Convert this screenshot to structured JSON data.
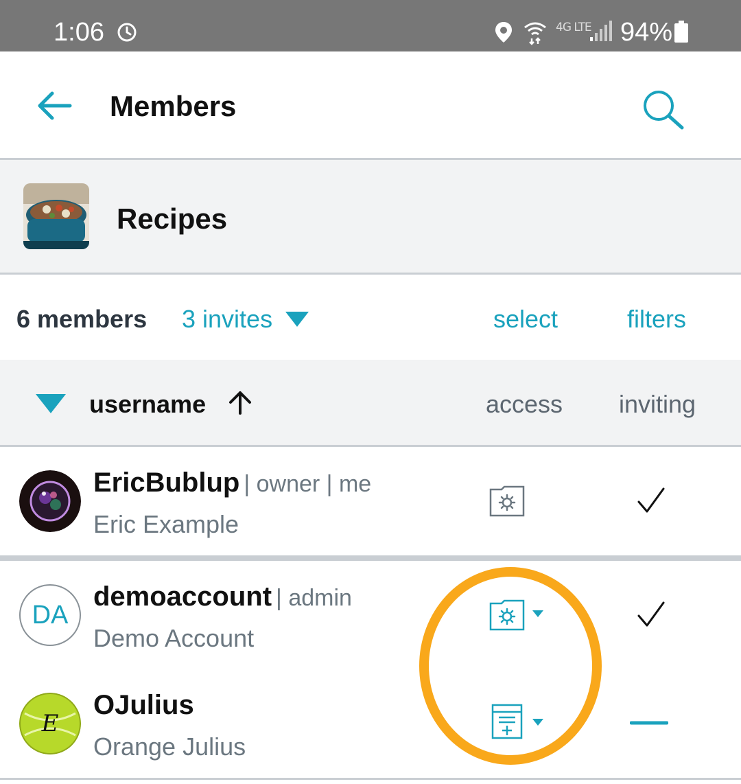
{
  "status_bar": {
    "time": "1:06",
    "network": "4G LTE",
    "battery": "94%",
    "icons": [
      "alarm-clock-icon",
      "location-icon",
      "wifi-icon",
      "signal-icon",
      "battery-icon"
    ]
  },
  "app_bar": {
    "title": "Members",
    "back_icon": "back-arrow-icon",
    "search_icon": "search-icon"
  },
  "group": {
    "name": "Recipes",
    "thumbnail": "recipe-photo"
  },
  "summary": {
    "members": "6 members",
    "invites": "3 invites",
    "select": "select",
    "filters": "filters"
  },
  "columns": {
    "username": "username",
    "access": "access",
    "inviting": "inviting",
    "sort": "ascending"
  },
  "members": [
    {
      "username": "EricBublup",
      "role": "| owner | me",
      "full_name": "Eric Example",
      "avatar": "bubble-photo",
      "access_icon": "folder-settings-icon",
      "access_editable": false,
      "inviting": "check"
    },
    {
      "username": "demoaccount",
      "role": "| admin",
      "full_name": "Demo Account",
      "avatar_initials": "DA",
      "access_icon": "folder-settings-icon",
      "access_editable": true,
      "inviting": "check"
    },
    {
      "username": "OJulius",
      "role": "",
      "full_name": "Orange Julius",
      "avatar": "tennis-ball-photo",
      "avatar_letter": "E",
      "access_icon": "add-document-icon",
      "access_editable": true,
      "inviting": "none"
    }
  ],
  "colors": {
    "accent": "#1aa2bd",
    "highlight": "#f9a81b",
    "status_bar": "#777777",
    "header_bg": "#f2f3f4"
  }
}
